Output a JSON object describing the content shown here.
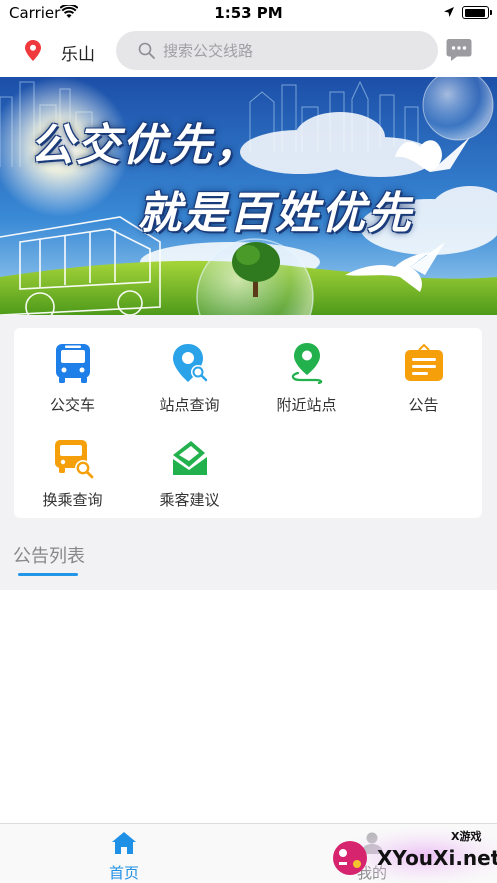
{
  "status_bar": {
    "carrier": "Carrier",
    "time": "1:53 PM",
    "battery_level": 0.95
  },
  "header": {
    "city": "乐山",
    "search_placeholder": "搜索公交线路"
  },
  "banner": {
    "line1": "公交优先，",
    "line2": "就是百姓优先"
  },
  "features": [
    {
      "label": "公交车",
      "icon": "bus-icon",
      "color": "#1e7fe8"
    },
    {
      "label": "站点查询",
      "icon": "station-search-icon",
      "color": "#2aa3e8"
    },
    {
      "label": "附近站点",
      "icon": "nearby-pin-icon",
      "color": "#22b14c"
    },
    {
      "label": "公告",
      "icon": "notice-board-icon",
      "color": "#f5a00b"
    },
    {
      "label": "换乘查询",
      "icon": "transfer-search-icon",
      "color": "#f5a00b"
    },
    {
      "label": "乘客建议",
      "icon": "feedback-mail-icon",
      "color": "#22b14c"
    }
  ],
  "notice": {
    "title": "公告列表"
  },
  "tabs": {
    "home": "首页",
    "mine": "我的"
  },
  "watermark": {
    "small": "X游戏",
    "big": "XYouXi.net"
  },
  "colors": {
    "accent": "#1e90e6",
    "underline": "#2196e8"
  }
}
